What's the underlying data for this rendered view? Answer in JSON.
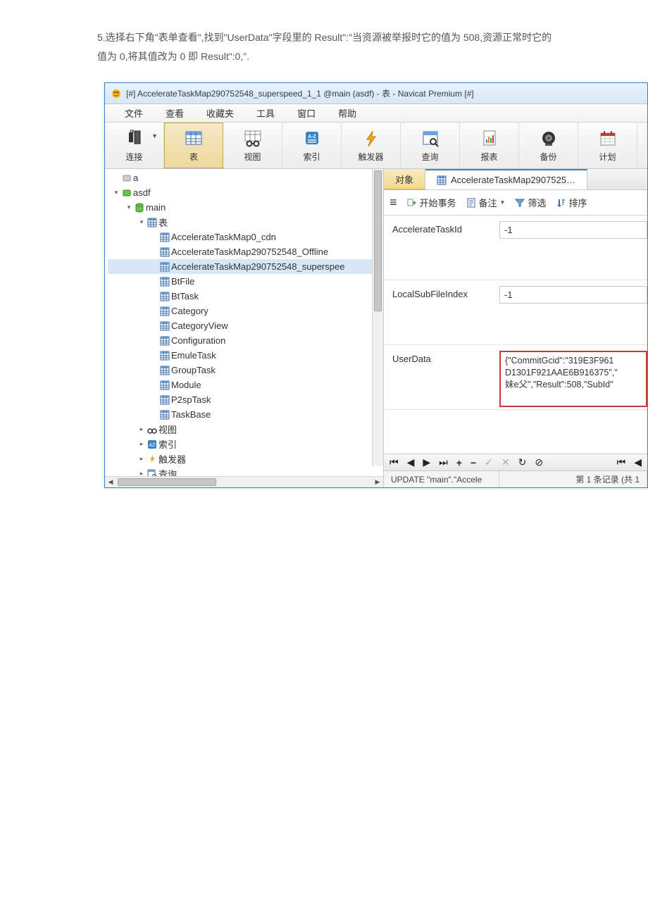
{
  "instruction": {
    "line1": "5.选择右下角\"表单查看\",找到\"UserData\"字段里的 Result\":\"当资源被举报时它的值为 508,资源正常时它的",
    "line2": "值为 0,将其值改为 0 即 Result\":0,\"."
  },
  "window": {
    "title": "[#] AccelerateTaskMap290752548_superspeed_1_1 @main (asdf) - 表 - Navicat Premium [#]"
  },
  "menu": [
    "文件",
    "查看",
    "收藏夹",
    "工具",
    "窗口",
    "帮助"
  ],
  "toolbar": [
    {
      "label": "连接",
      "icon": "plug",
      "caret": true
    },
    {
      "label": "表",
      "icon": "table",
      "selected": true
    },
    {
      "label": "视图",
      "icon": "view"
    },
    {
      "label": "索引",
      "icon": "index"
    },
    {
      "label": "触发器",
      "icon": "trigger"
    },
    {
      "label": "查询",
      "icon": "query"
    },
    {
      "label": "报表",
      "icon": "report"
    },
    {
      "label": "备份",
      "icon": "backup"
    },
    {
      "label": "计划",
      "icon": "schedule"
    }
  ],
  "tree": [
    {
      "indent": 0,
      "arrow": "",
      "icon": "conn-gray",
      "label": "a"
    },
    {
      "indent": 0,
      "arrow": "▾",
      "icon": "conn-green",
      "label": "asdf"
    },
    {
      "indent": 1,
      "arrow": "▾",
      "icon": "db",
      "label": "main"
    },
    {
      "indent": 2,
      "arrow": "▾",
      "icon": "tables",
      "label": "表"
    },
    {
      "indent": 3,
      "arrow": "",
      "icon": "tbl",
      "label": "AccelerateTaskMap0_cdn"
    },
    {
      "indent": 3,
      "arrow": "",
      "icon": "tbl",
      "label": "AccelerateTaskMap290752548_Offline"
    },
    {
      "indent": 3,
      "arrow": "",
      "icon": "tbl",
      "label": "AccelerateTaskMap290752548_superspee",
      "selected": true
    },
    {
      "indent": 3,
      "arrow": "",
      "icon": "tbl",
      "label": "BtFile"
    },
    {
      "indent": 3,
      "arrow": "",
      "icon": "tbl",
      "label": "BtTask"
    },
    {
      "indent": 3,
      "arrow": "",
      "icon": "tbl",
      "label": "Category"
    },
    {
      "indent": 3,
      "arrow": "",
      "icon": "tbl",
      "label": "CategoryView"
    },
    {
      "indent": 3,
      "arrow": "",
      "icon": "tbl",
      "label": "Configuration"
    },
    {
      "indent": 3,
      "arrow": "",
      "icon": "tbl",
      "label": "EmuleTask"
    },
    {
      "indent": 3,
      "arrow": "",
      "icon": "tbl",
      "label": "GroupTask"
    },
    {
      "indent": 3,
      "arrow": "",
      "icon": "tbl",
      "label": "Module"
    },
    {
      "indent": 3,
      "arrow": "",
      "icon": "tbl",
      "label": "P2spTask"
    },
    {
      "indent": 3,
      "arrow": "",
      "icon": "tbl",
      "label": "TaskBase"
    },
    {
      "indent": 2,
      "arrow": "▸",
      "icon": "view2",
      "label": "视图"
    },
    {
      "indent": 2,
      "arrow": "▸",
      "icon": "index2",
      "label": "索引"
    },
    {
      "indent": 2,
      "arrow": "▸",
      "icon": "trigger2",
      "label": "触发器"
    },
    {
      "indent": 2,
      "arrow": "▸",
      "icon": "query2",
      "label": "查询"
    }
  ],
  "tabs": {
    "objects": "对象",
    "active": "AccelerateTaskMap2907525…"
  },
  "subbar": {
    "menu": "≡",
    "start": "开始事务",
    "note": "备注",
    "filter": "筛选",
    "sort": "排序"
  },
  "form": [
    {
      "label": "AccelerateTaskId",
      "value": "-1"
    },
    {
      "label": "LocalSubFileIndex",
      "value": "-1"
    },
    {
      "label": "UserData",
      "value": "{\"CommitGcid\":\"319E3F961\nD1301F921AAE6B916375\",\"\n妹e父\",\"Result\":508,\"SubId\"",
      "highlight": true
    }
  ],
  "status": {
    "left": "UPDATE \"main\".\"Accele",
    "right": "第 1 条记录 (共 1"
  }
}
